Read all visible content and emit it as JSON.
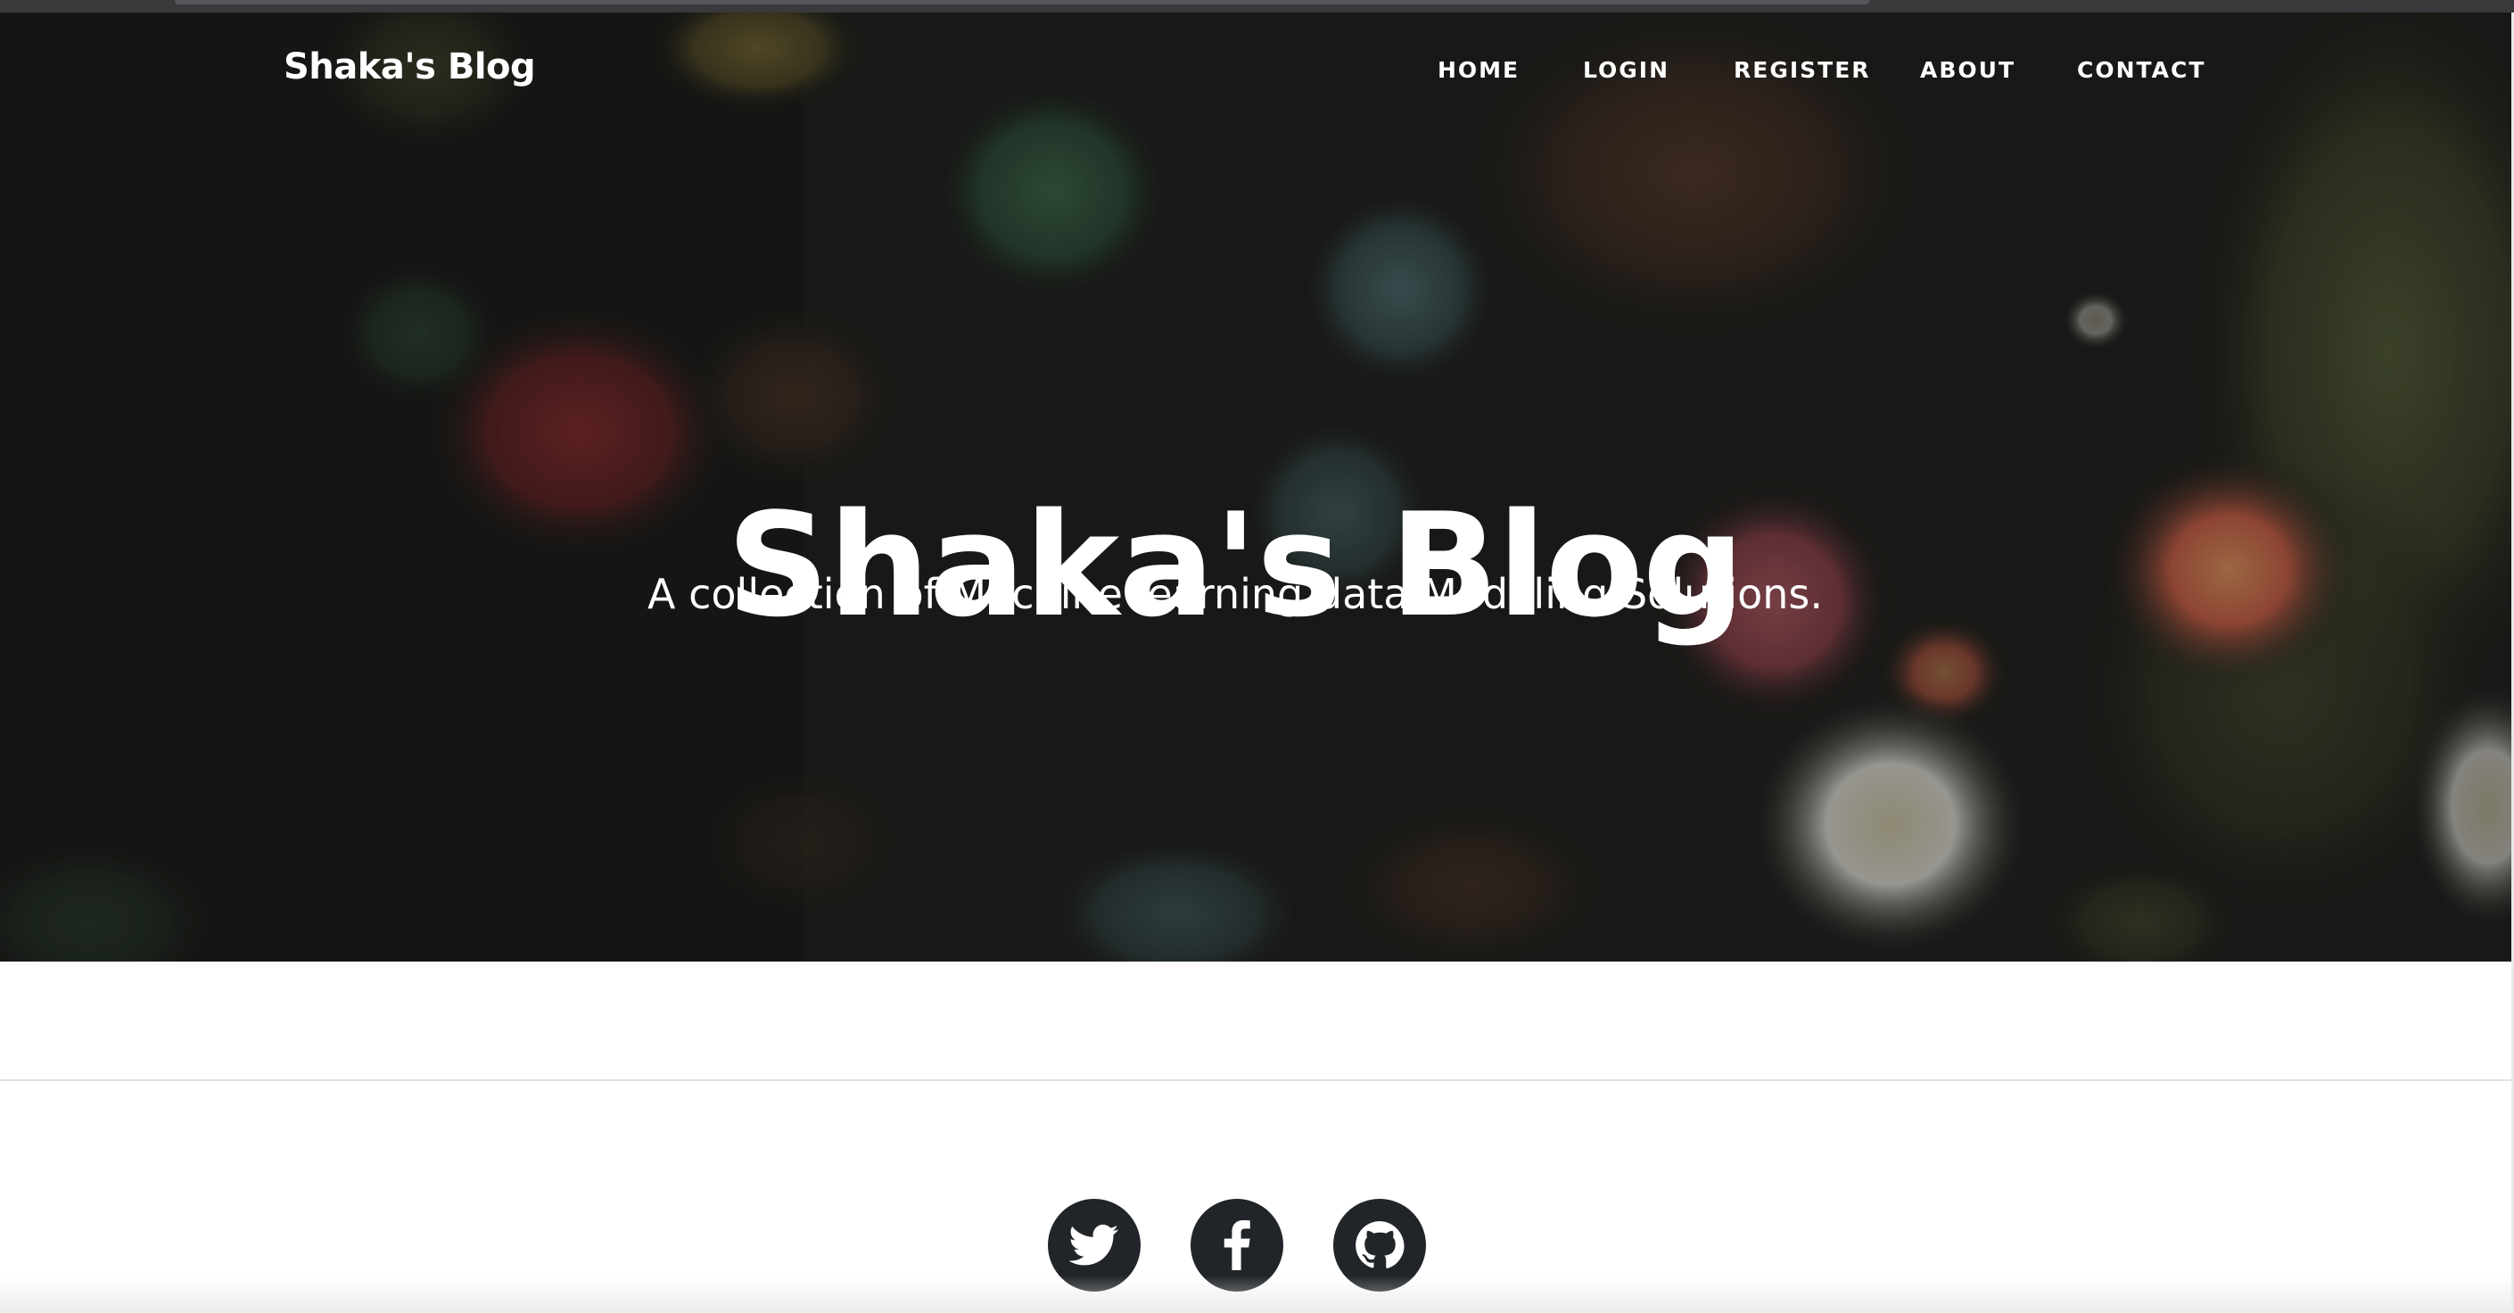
{
  "navbar": {
    "brand": "Shaka's Blog",
    "links": [
      {
        "label": "HOME"
      },
      {
        "label": "LOGIN"
      },
      {
        "label": "REGISTER"
      },
      {
        "label": "ABOUT"
      },
      {
        "label": "CONTACT"
      }
    ]
  },
  "hero": {
    "title": "Shaka's Blog",
    "subtitle": "A collection of Machine learning data Modeling Solutions.",
    "background": "dark sea anemone photo"
  },
  "social": [
    {
      "icon": "twitter-icon"
    },
    {
      "icon": "facebook-icon"
    },
    {
      "icon": "github-icon"
    }
  ],
  "colors": {
    "social_button": "#212529",
    "nav_text": "#ffffff",
    "divider": "#dfe1e3"
  }
}
